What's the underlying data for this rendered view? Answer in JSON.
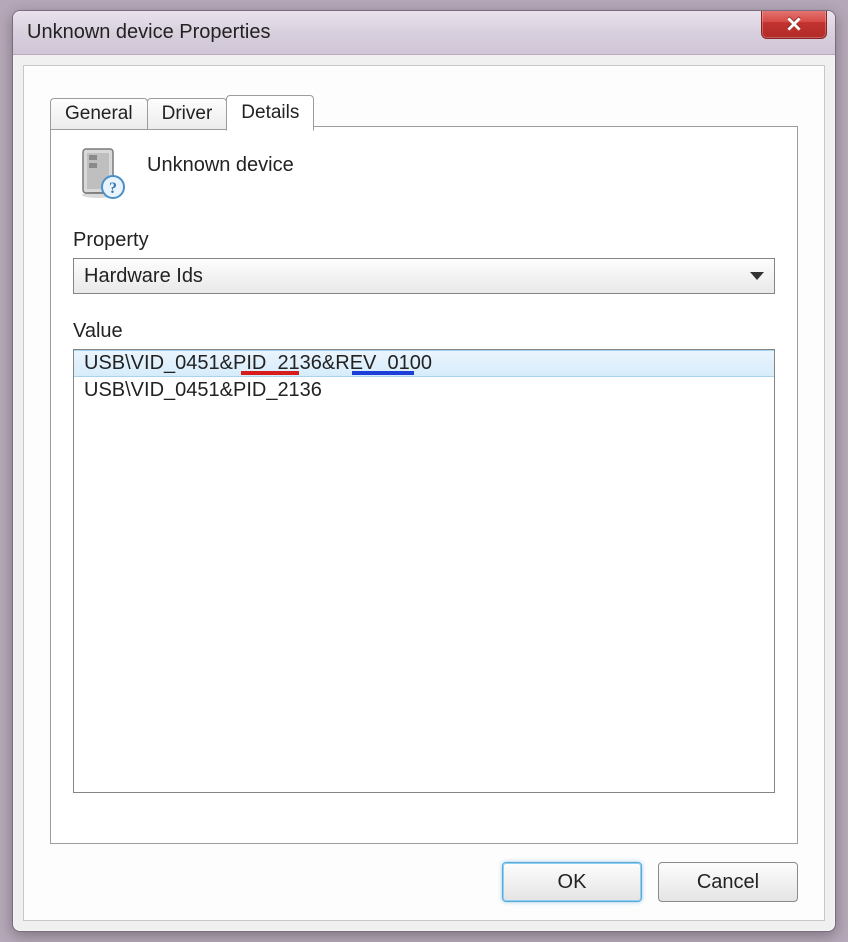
{
  "window": {
    "title": "Unknown device Properties"
  },
  "tabs": {
    "general": "General",
    "driver": "Driver",
    "details": "Details"
  },
  "device": {
    "name": "Unknown device"
  },
  "property_label": "Property",
  "property_selected": "Hardware Ids",
  "value_label": "Value",
  "values": [
    "USB\\VID_0451&PID_2136&REV_0100",
    "USB\\VID_0451&PID_2136"
  ],
  "buttons": {
    "ok": "OK",
    "cancel": "Cancel"
  }
}
